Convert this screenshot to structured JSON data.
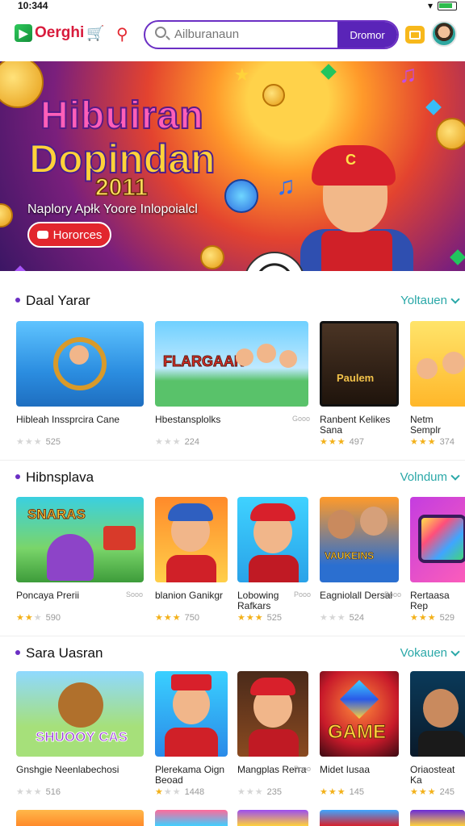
{
  "status": {
    "time": "10:344"
  },
  "header": {
    "logo": "Oerghi",
    "search_placeholder": "Ailburanaun",
    "search_button": "Dromor"
  },
  "hero": {
    "title_line1": "Hibuiran",
    "title_line2": "Dopindan",
    "year": "2011",
    "subtitle": "Naplory Apłk Yoore Inlopoialcl",
    "button": "Hororces"
  },
  "sections": [
    {
      "title": "Daal Yarar",
      "more": "Yoltauen",
      "cards": [
        {
          "name": "Hibleah Inssprcira Cane",
          "side": "",
          "stars": 0,
          "count": "525"
        },
        {
          "name": "Hbestansplolks",
          "side": "Gooo",
          "stars": 0,
          "count": "224"
        },
        {
          "name": "Ranbent Kelikes Sana",
          "side": "",
          "stars": 3,
          "count": "497"
        },
        {
          "name": "Netm Semplr",
          "side": "",
          "stars": 3,
          "count": "374"
        }
      ]
    },
    {
      "title": "Hibnsplava",
      "more": "Volndum",
      "cards": [
        {
          "name": "Poncaya Prerii",
          "side": "Sooo",
          "stars": 2,
          "count": "590"
        },
        {
          "name": "blanion Ganikgr",
          "side": "",
          "stars": 3,
          "count": "750"
        },
        {
          "name": "Lobowing Rafkars",
          "side": "Pooo",
          "stars": 3,
          "count": "525"
        },
        {
          "name": "Eagniolall Dersal",
          "side": "Booo",
          "stars": 0,
          "count": "524"
        },
        {
          "name": "Rertaasa Rep",
          "side": "",
          "stars": 3,
          "count": "529"
        }
      ]
    },
    {
      "title": "Sara Uasran",
      "more": "Vokauen",
      "cards": [
        {
          "name": "Gnshgie Neenlabechosi",
          "side": "",
          "stars": 0,
          "count": "516"
        },
        {
          "name": "Plerekama Oign Beoad",
          "side": "",
          "stars": 1,
          "count": "1448"
        },
        {
          "name": "Mangplas Rerra",
          "side": "Pooo",
          "stars": 0,
          "count": "235"
        },
        {
          "name": "Midet Iusaa",
          "side": "",
          "stars": 3,
          "count": "145"
        },
        {
          "name": "Oriaosteat Ka",
          "side": "",
          "stars": 3,
          "count": "245"
        }
      ]
    }
  ],
  "colors": {
    "accent": "#5a24b8",
    "link": "#2aa8a8",
    "star": "#f3b11a",
    "brand": "#d81b3c"
  }
}
